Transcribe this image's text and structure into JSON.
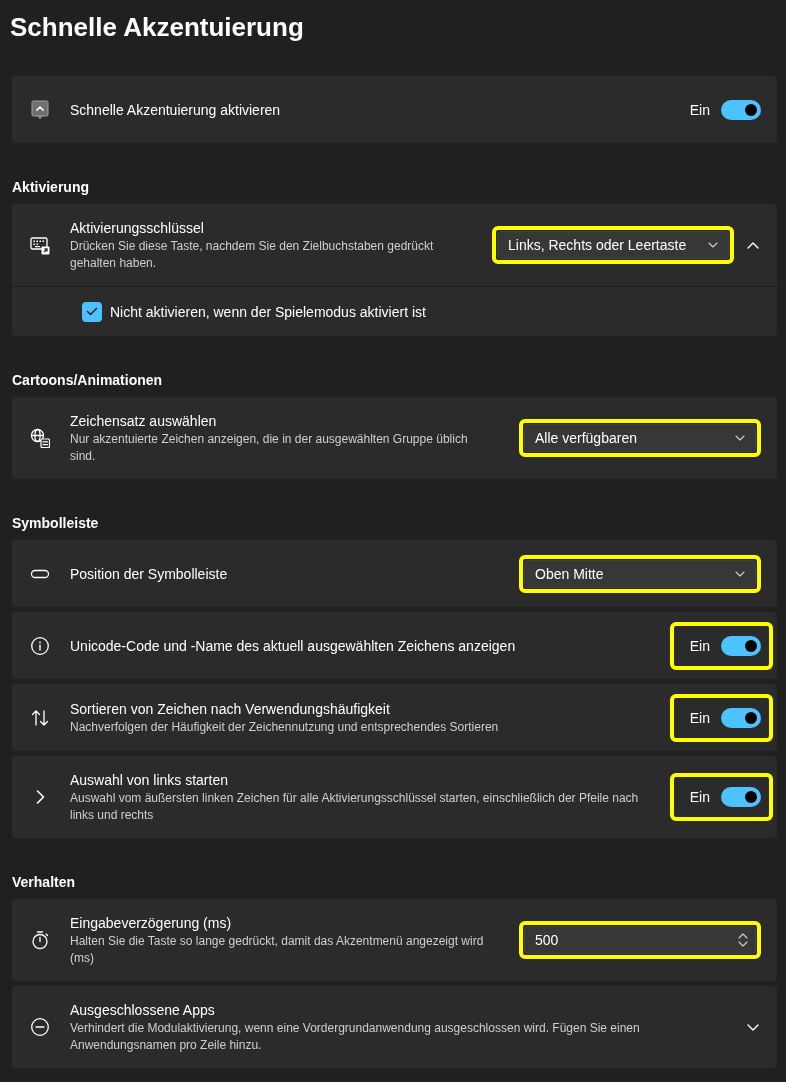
{
  "page_title": "Schnelle Akzentuierung",
  "groups": [
    {
      "cards": [
        {
          "title": "Schnelle Akzentuierung aktivieren",
          "control": {
            "kind": "toggle",
            "state_label": "Ein",
            "on": true,
            "highlighted": false
          }
        }
      ]
    },
    {
      "header": "Aktivierung",
      "cards": [
        {
          "title": "Aktivierungsschlüssel",
          "description": "Drücken Sie diese Taste, nachdem Sie den Zielbuchstaben gedrückt gehalten haben.",
          "control": {
            "kind": "dropdown",
            "value": "Links, Rechts oder Leertaste",
            "highlighted": true
          },
          "expanded": true,
          "sub_settings": [
            {
              "kind": "checkbox",
              "label": "Nicht aktivieren, wenn der Spielemodus aktiviert ist",
              "checked": true
            }
          ]
        }
      ]
    },
    {
      "header": "Cartoons/Animationen",
      "cards": [
        {
          "title": "Zeichensatz auswählen",
          "description": "Nur akzentuierte Zeichen anzeigen, die in der ausgewählten Gruppe üblich sind.",
          "control": {
            "kind": "dropdown",
            "value": "Alle verfügbaren",
            "highlighted": true
          }
        }
      ]
    },
    {
      "header": "Symbolleiste",
      "cards": [
        {
          "title": "Position der Symbolleiste",
          "control": {
            "kind": "dropdown",
            "value": "Oben Mitte",
            "highlighted": true
          }
        },
        {
          "title": "Unicode-Code und -Name des aktuell ausgewählten Zeichens anzeigen",
          "control": {
            "kind": "toggle",
            "state_label": "Ein",
            "on": true,
            "highlighted": true
          }
        },
        {
          "title": "Sortieren von Zeichen nach Verwendungshäufigkeit",
          "description": "Nachverfolgen der Häufigkeit der Zeichennutzung und entsprechendes Sortieren",
          "control": {
            "kind": "toggle",
            "state_label": "Ein",
            "on": true,
            "highlighted": true
          }
        },
        {
          "title": "Auswahl von links starten",
          "description": "Auswahl vom äußersten linken Zeichen für alle Aktivierungsschlüssel starten, einschließlich der Pfeile nach links und rechts",
          "control": {
            "kind": "toggle",
            "state_label": "Ein",
            "on": true,
            "highlighted": true
          }
        }
      ]
    },
    {
      "header": "Verhalten",
      "cards": [
        {
          "title": "Eingabeverzögerung (ms)",
          "description": "Halten Sie die Taste so lange gedrückt, damit das Akzentmenü angezeigt wird (ms)",
          "control": {
            "kind": "number",
            "value": "500",
            "highlighted": true
          }
        },
        {
          "title": "Ausgeschlossene Apps",
          "description": "Verhindert die Modulaktivierung, wenn eine Vordergrundanwendung ausgeschlossen wird. Fügen Sie einen Anwendungsnamen pro Zeile hinzu.",
          "expanded": false
        }
      ]
    }
  ]
}
